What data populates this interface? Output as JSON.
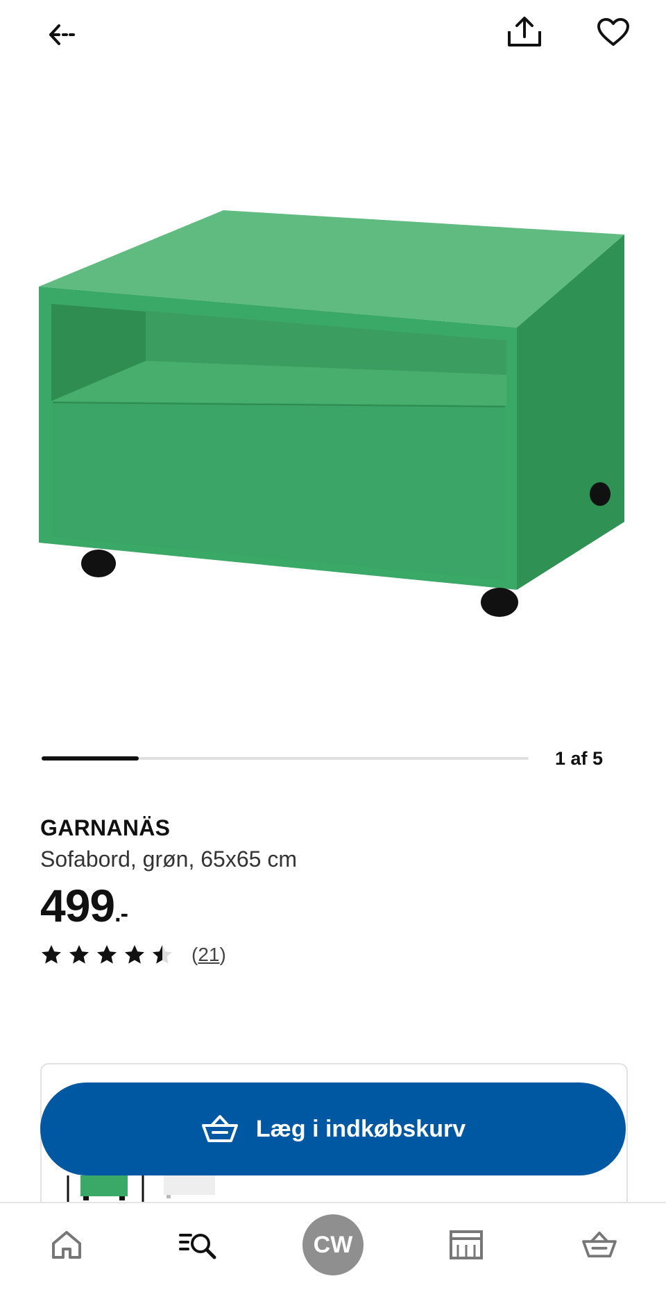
{
  "header": {
    "back_icon": "back-arrow-icon",
    "share_icon": "share-icon",
    "favorite_icon": "heart-icon"
  },
  "gallery": {
    "counter": "1 af 5",
    "position": 1,
    "total": 5,
    "product_color": "#3aa866"
  },
  "product": {
    "name": "GARNANÄS",
    "description": "Sofabord, grøn, 65x65 cm",
    "price": "499",
    "price_suffix": ".-",
    "rating": 4.5,
    "review_count": "21"
  },
  "cart": {
    "label": "Læg i indkøbskurv",
    "icon": "basket-icon",
    "color": "#0058a3"
  },
  "variants": [
    {
      "color": "#3aa866"
    },
    {
      "color": "#eeeeee"
    }
  ],
  "nav": {
    "items": [
      {
        "icon": "home-icon"
      },
      {
        "icon": "search-icon"
      },
      {
        "icon": "avatar",
        "initials": "CW"
      },
      {
        "icon": "store-icon"
      },
      {
        "icon": "basket-icon"
      }
    ]
  }
}
